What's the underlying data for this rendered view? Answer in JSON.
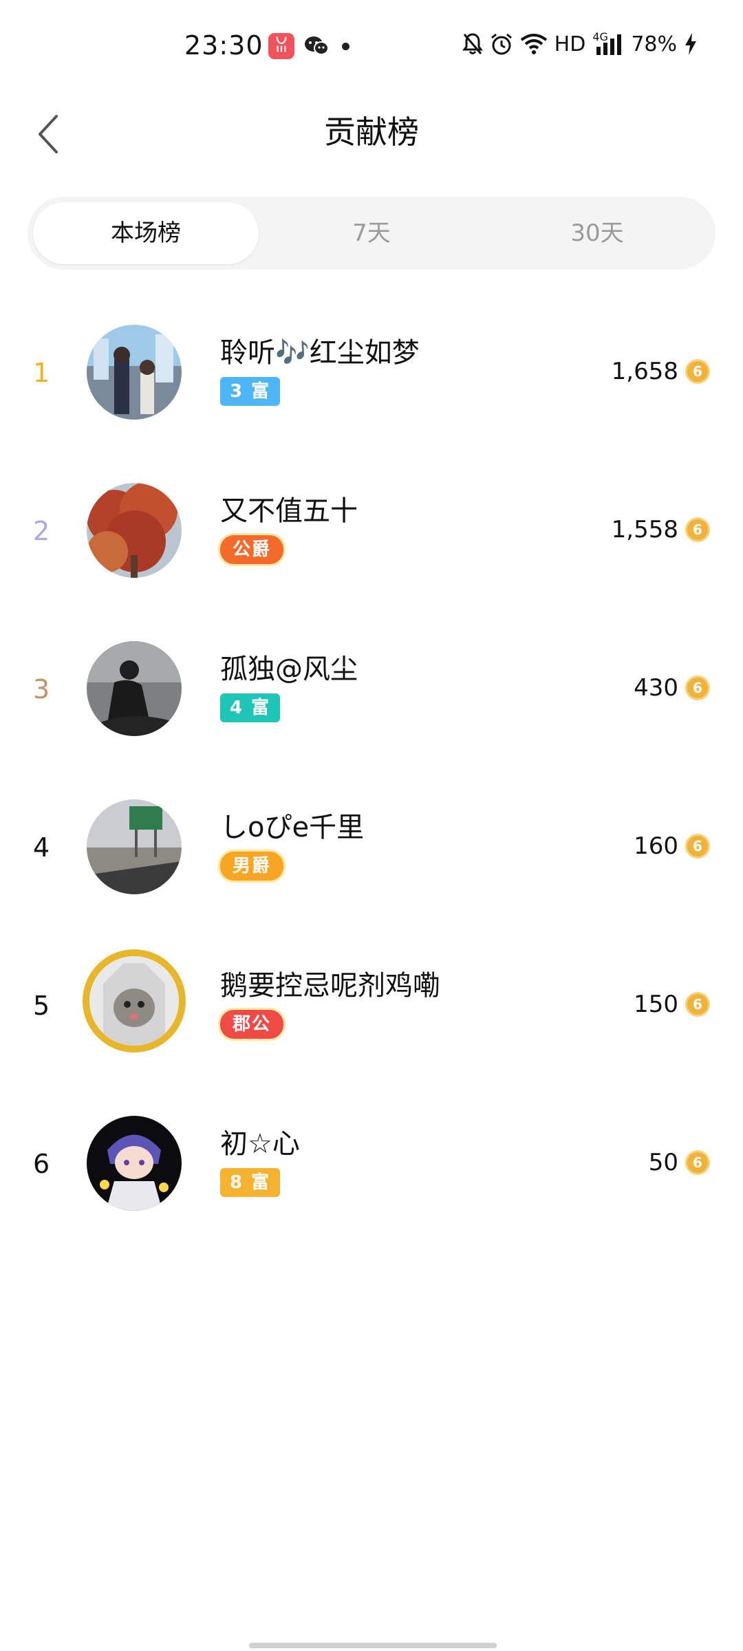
{
  "status_bar": {
    "time": "23:30",
    "network": "HD",
    "cellular": "4G",
    "battery": "78%",
    "icons": [
      "app-notification-icon",
      "wechat-icon",
      "dot-icon",
      "bell-off-icon",
      "alarm-icon",
      "wifi-icon",
      "signal-icon",
      "charging-icon"
    ]
  },
  "header": {
    "title": "贡献榜",
    "back_icon": "chevron-left-icon"
  },
  "tabs": [
    {
      "label": "本场榜",
      "active": true
    },
    {
      "label": "7天",
      "active": false
    },
    {
      "label": "30天",
      "active": false
    }
  ],
  "ranking": [
    {
      "rank": "1",
      "rank_color": "#f2b01e",
      "name": "聆听🎶红尘如梦",
      "badge": "3 富",
      "badge_color": "#4fb6f5",
      "badge_type": "rich",
      "score": "1,658",
      "avatar_icon": "anime-couple-avatar"
    },
    {
      "rank": "2",
      "rank_color": "#a9a7e6",
      "name": "又不值五十",
      "badge": "公爵",
      "badge_color": "#f36a2a",
      "badge_type": "noble",
      "score": "1,558",
      "avatar_icon": "red-tree-avatar"
    },
    {
      "rank": "3",
      "rank_color": "#c59262",
      "name": "孤独@风尘",
      "badge": "4 富",
      "badge_color": "#1fc6b7",
      "badge_type": "rich",
      "score": "430",
      "avatar_icon": "silhouette-avatar"
    },
    {
      "rank": "4",
      "rank_color": "#111111",
      "name": "しoぴe千里",
      "badge": "男爵",
      "badge_color": "#f7a525",
      "badge_type": "noble",
      "score": "160",
      "avatar_icon": "highway-sign-avatar"
    },
    {
      "rank": "5",
      "rank_color": "#111111",
      "name": "鹅要控忌呢剂鸡嘞",
      "badge": "郡公",
      "badge_color": "#ee4b47",
      "badge_type": "noble",
      "score": "150",
      "avatar_icon": "cat-avatar-gold-frame"
    },
    {
      "rank": "6",
      "rank_color": "#111111",
      "name": "初☆心",
      "badge": "8 富",
      "badge_color": "#f5b130",
      "badge_type": "rich",
      "score": "50",
      "avatar_icon": "anime-boy-avatar"
    }
  ],
  "coin_symbol": "6",
  "colors": {
    "tab_bg": "#f4f4f4",
    "coin": "#f0b23a"
  }
}
